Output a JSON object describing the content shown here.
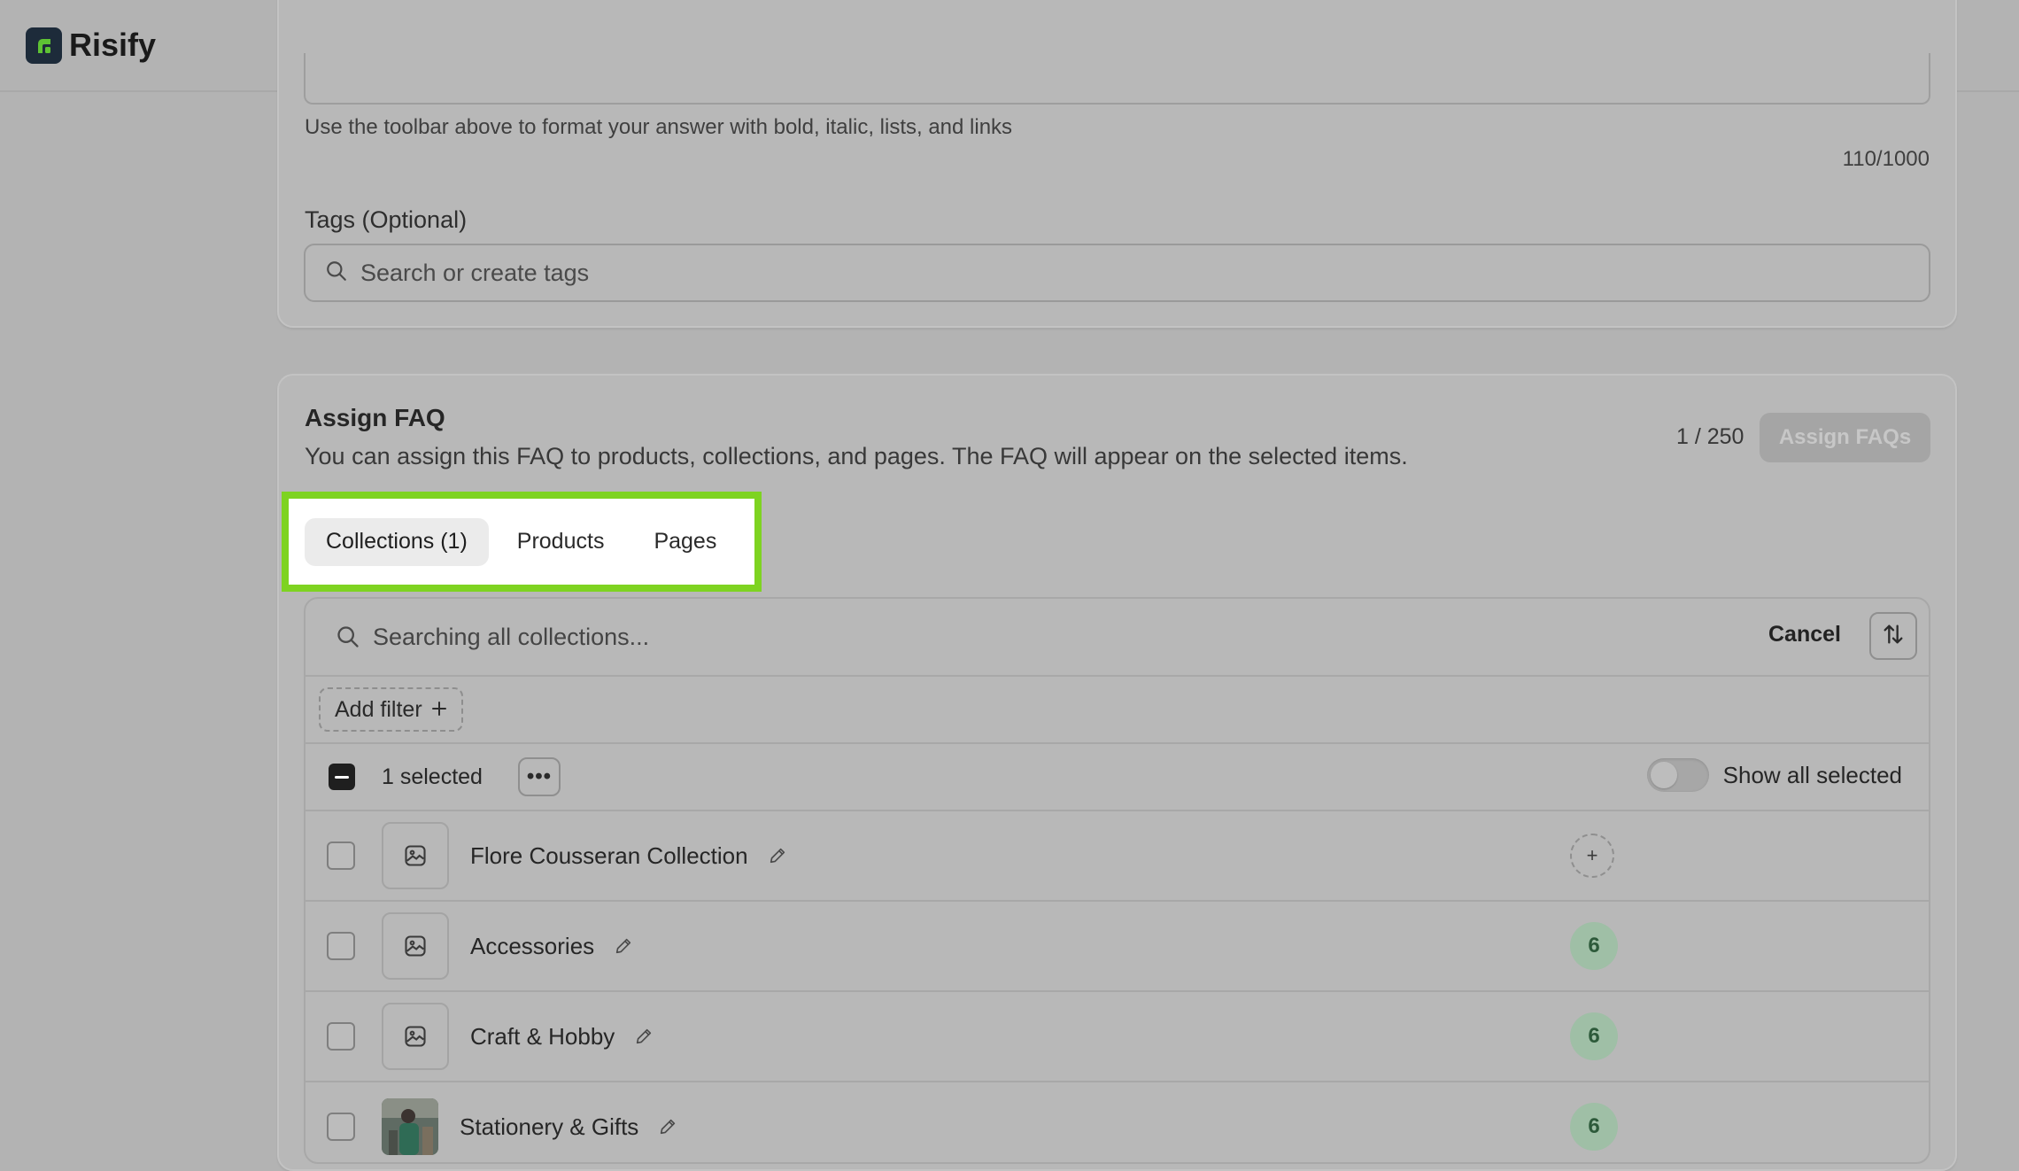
{
  "app": {
    "name": "Risify"
  },
  "answer_section": {
    "helper_text": "Use the toolbar above to format your answer with bold, italic, lists, and links",
    "char_counter": "110/1000",
    "tags_label": "Tags (Optional)",
    "tags_placeholder": "Search or create tags"
  },
  "assign": {
    "title": "Assign FAQ",
    "description": "You can assign this FAQ to products, collections, and pages. The FAQ will appear on the selected items.",
    "quota": "1 / 250",
    "assign_button": "Assign FAQs",
    "tabs": [
      {
        "label": "Collections (1)",
        "active": true
      },
      {
        "label": "Products",
        "active": false
      },
      {
        "label": "Pages",
        "active": false
      }
    ],
    "search_placeholder": "Searching all collections...",
    "cancel_label": "Cancel",
    "add_filter_label": "Add filter",
    "selected_text": "1 selected",
    "more_label": "•••",
    "show_all_selected_label": "Show all selected",
    "show_all_selected_on": false,
    "items": [
      {
        "name": "Flore Cousseran Collection",
        "badge": "+",
        "badge_type": "add",
        "thumb": "image-placeholder-icon"
      },
      {
        "name": "Accessories",
        "badge": "6",
        "badge_type": "count",
        "thumb": "image-placeholder-icon"
      },
      {
        "name": "Craft & Hobby",
        "badge": "6",
        "badge_type": "count",
        "thumb": "image-placeholder-icon"
      },
      {
        "name": "Stationery & Gifts",
        "badge": "6",
        "badge_type": "count",
        "thumb": "photo"
      }
    ]
  },
  "colors": {
    "highlight": "#7ed321",
    "badge_bg": "#9fbfa6",
    "badge_text": "#2d5a3a"
  }
}
